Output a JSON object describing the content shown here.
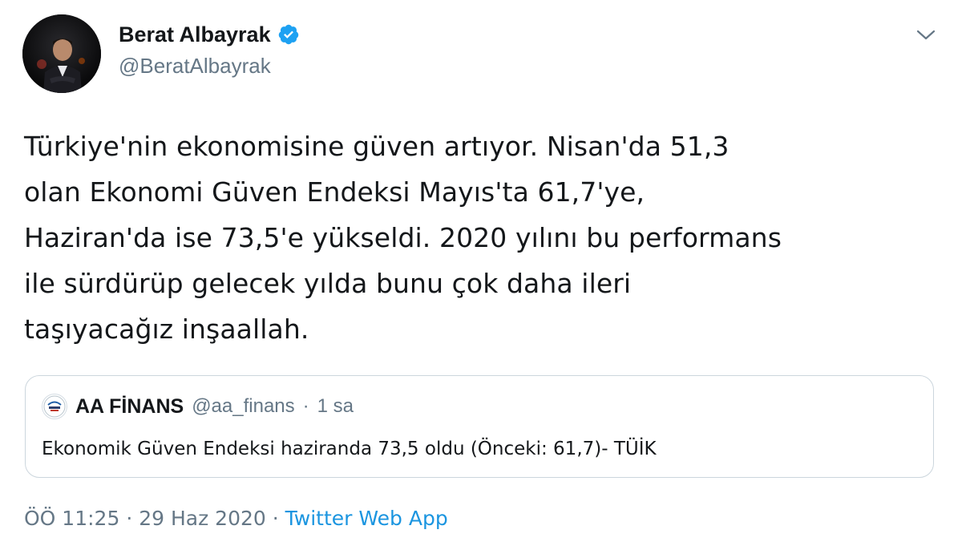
{
  "author": {
    "display_name": "Berat Albayrak",
    "handle": "@BeratAlbayrak",
    "verified": true
  },
  "tweet": {
    "text": "Türkiye'nin ekonomisine güven artıyor. Nisan'da 51,3\nolan Ekonomi Güven Endeksi Mayıs'ta 61,7'ye,\nHaziran'da ise 73,5'e yükseldi. 2020 yılını bu performans\nile sürdürüp gelecek yılda bunu çok daha ileri\ntaşıyacağız inşaallah."
  },
  "quoted_tweet": {
    "display_name": "AA FİNANS",
    "handle": "@aa_finans",
    "separator": "·",
    "time": "1 sa",
    "text": "Ekonomik Güven Endeksi haziranda 73,5 oldu (Önceki: 61,7)- TÜİK"
  },
  "meta": {
    "time": "ÖÖ 11:25",
    "separator1": "·",
    "date": "29 Haz 2020",
    "separator2": "·",
    "source": "Twitter Web App"
  },
  "colors": {
    "verified_badge": "#1da1f2",
    "link": "#1b95e0",
    "secondary_text": "#657786",
    "border": "#ccd6dd"
  },
  "icons": {
    "verified": "verified-badge-icon",
    "menu": "chevron-down-icon"
  }
}
